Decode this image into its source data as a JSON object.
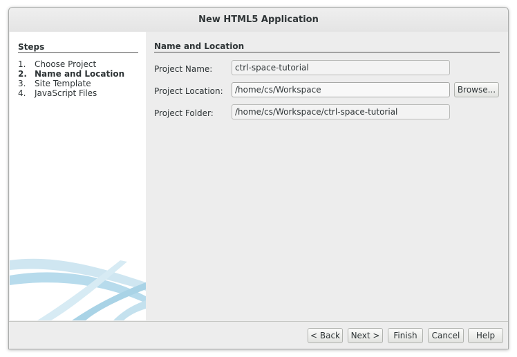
{
  "window": {
    "title": "New HTML5 Application"
  },
  "steps": {
    "heading": "Steps",
    "items": [
      {
        "num": "1.",
        "label": "Choose Project"
      },
      {
        "num": "2.",
        "label": "Name and Location"
      },
      {
        "num": "3.",
        "label": "Site Template"
      },
      {
        "num": "4.",
        "label": "JavaScript Files"
      }
    ],
    "current_index": 1
  },
  "content": {
    "heading": "Name and Location",
    "project_name": {
      "label": "Project Name:",
      "value": "ctrl-space-tutorial"
    },
    "project_location": {
      "label": "Project Location:",
      "value": "/home/cs/Workspace"
    },
    "project_folder": {
      "label": "Project Folder:",
      "value": "/home/cs/Workspace/ctrl-space-tutorial"
    },
    "browse_label": "Browse..."
  },
  "footer": {
    "back_label": "< Back",
    "next_label": "Next >",
    "finish_label": "Finish",
    "cancel_label": "Cancel",
    "help_label": "Help"
  },
  "colors": {
    "window_bg": "#ededed",
    "panel_bg": "#ffffff",
    "swoosh": "#a9d3e6"
  }
}
